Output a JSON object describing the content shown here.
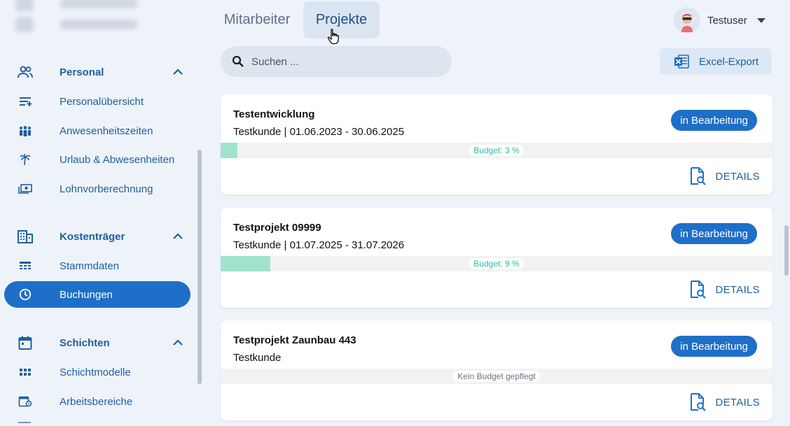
{
  "sidebar": {
    "groups": [
      {
        "label": "Personal",
        "icon": "people-icon",
        "items": [
          {
            "label": "Personalübersicht",
            "icon": "list-filter-icon"
          },
          {
            "label": "Anwesenheitszeiten",
            "icon": "group-icon"
          },
          {
            "label": "Urlaub & Abwesenheiten",
            "icon": "palm-tree-icon"
          },
          {
            "label": "Lohnvorberechnung",
            "icon": "money-icon"
          }
        ]
      },
      {
        "label": "Kostenträger",
        "icon": "building-icon",
        "items": [
          {
            "label": "Stammdaten",
            "icon": "table-icon"
          },
          {
            "label": "Buchungen",
            "icon": "clock-icon",
            "active": true
          }
        ]
      },
      {
        "label": "Schichten",
        "icon": "calendar-icon",
        "items": [
          {
            "label": "Schichtmodelle",
            "icon": "grid-icon"
          },
          {
            "label": "Arbeitsbereiche",
            "icon": "calendar-pin-icon"
          }
        ]
      }
    ]
  },
  "tabs": [
    {
      "label": "Mitarbeiter",
      "active": false
    },
    {
      "label": "Projekte",
      "active": true
    }
  ],
  "user": {
    "name": "Testuser"
  },
  "search": {
    "placeholder": "Suchen ..."
  },
  "export": {
    "label": "Excel-Export"
  },
  "projects": [
    {
      "title": "Testentwicklung",
      "subtitle": "Testkunde | 01.06.2023 - 30.06.2025",
      "status": "in Bearbeitung",
      "budget_label": "Budget: 3 %",
      "budget_percent": 3,
      "details_label": "DETAILS"
    },
    {
      "title": "Testprojekt 09999",
      "subtitle": "Testkunde | 01.07.2025 - 31.07.2026",
      "status": "in Bearbeitung",
      "budget_label": "Budget: 9 %",
      "budget_percent": 9,
      "details_label": "DETAILS"
    },
    {
      "title": "Testprojekt Zaunbau 443",
      "subtitle": "Testkunde",
      "status": "in Bearbeitung",
      "budget_label": "Kein Budget gepflegt",
      "budget_percent": null,
      "details_label": "DETAILS"
    }
  ],
  "colors": {
    "primary": "#1e6fc7",
    "accent_text": "#1f5f9e",
    "budget_fill": "#9fe3cc",
    "budget_text": "#2cc097",
    "background": "#eef3fa"
  }
}
